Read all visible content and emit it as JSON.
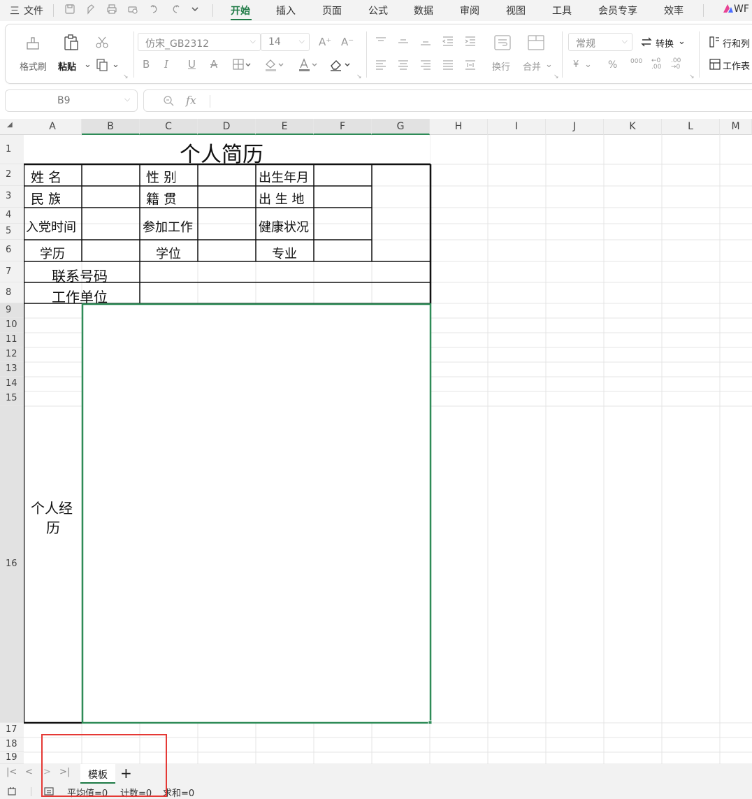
{
  "menu": {
    "hamburger": "三",
    "file": "文件",
    "tabs": [
      "开始",
      "插入",
      "页面",
      "公式",
      "数据",
      "审阅",
      "视图",
      "工具",
      "会员专享",
      "效率"
    ],
    "active_tab": "开始",
    "wps_ai": "WF"
  },
  "ribbon": {
    "format_painter": "格式刷",
    "paste": "粘贴",
    "font_name": "仿宋_GB2312",
    "font_size": "14",
    "grow_font": "A⁺",
    "shrink_font": "A⁻",
    "bold": "B",
    "italic": "I",
    "underline": "U",
    "strike": "A",
    "wrap": "换行",
    "merge": "合并",
    "number_format": "常规",
    "convert": "转换",
    "currency": "¥",
    "percent": "%",
    "thousands": "000",
    "inc_decimal": "←0 .00",
    "dec_decimal": ".00 →0",
    "rows_cols": "行和列",
    "worksheet": "工作表"
  },
  "formula_bar": {
    "name_box": "B9",
    "fx": "fx",
    "value": ""
  },
  "columns": [
    "A",
    "B",
    "C",
    "D",
    "E",
    "F",
    "G",
    "H",
    "I",
    "J",
    "K",
    "L",
    "M"
  ],
  "selected_columns": [
    "B",
    "C",
    "D",
    "E",
    "F",
    "G"
  ],
  "rows": [
    "1",
    "2",
    "3",
    "4",
    "5",
    "6",
    "7",
    "8",
    "9",
    "10",
    "11",
    "12",
    "13",
    "14",
    "15",
    "16",
    "17",
    "18",
    "19"
  ],
  "selected_rows": [
    "9",
    "10",
    "11",
    "12",
    "13",
    "14",
    "15",
    "16"
  ],
  "resume": {
    "title": "个人简历",
    "name": "姓  名",
    "gender": "性  别",
    "birth": "出生年月",
    "ethnicity": "民  族",
    "native_place": "籍  贯",
    "birthplace": "出 生 地",
    "party_join": "入党时间",
    "work_start": "参加工作",
    "health": "健康状况",
    "education": "学历",
    "degree": "学位",
    "major": "专业",
    "phone": "联系号码",
    "employer": "工作单位",
    "experience_line1": "个人经",
    "experience_line2": "历"
  },
  "sheets": {
    "nav_first": "|<",
    "nav_prev": "<",
    "nav_next": ">",
    "nav_last": ">|",
    "active": "模板",
    "add": "+"
  },
  "status": {
    "average": "平均值=0",
    "count": "计数=0",
    "sum": "求和=0"
  },
  "colors": {
    "accent": "#1e7a45",
    "selection": "#2e8b57",
    "highlight_box": "#e53935"
  }
}
